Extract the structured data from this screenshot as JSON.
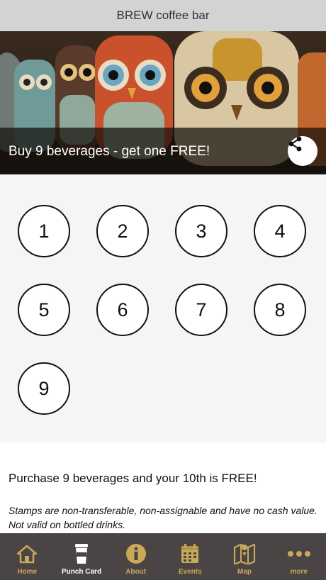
{
  "header": {
    "title": "BREW coffee bar"
  },
  "hero": {
    "title": "Buy 9 beverages - get one FREE!",
    "share_icon": "share-icon"
  },
  "punch_card": {
    "stamps": [
      "1",
      "2",
      "3",
      "4",
      "5",
      "6",
      "7",
      "8",
      "9"
    ]
  },
  "description": "Purchase 9 beverages and your 10th is FREE!",
  "terms": "Stamps are non-transferable, non-assignable and have no cash value. Not valid on bottled drinks.",
  "tabs": [
    {
      "label": "Home",
      "icon": "home-icon"
    },
    {
      "label": "Punch Card",
      "icon": "coffee-cup-icon",
      "active": true
    },
    {
      "label": "About",
      "icon": "info-icon"
    },
    {
      "label": "Events",
      "icon": "calendar-icon"
    },
    {
      "label": "Map",
      "icon": "map-icon"
    },
    {
      "label": "more",
      "icon": "more-icon"
    }
  ],
  "colors": {
    "tab_accent": "#c9a85a",
    "tab_background": "#4a4444",
    "topbar": "#d3d3d3"
  }
}
